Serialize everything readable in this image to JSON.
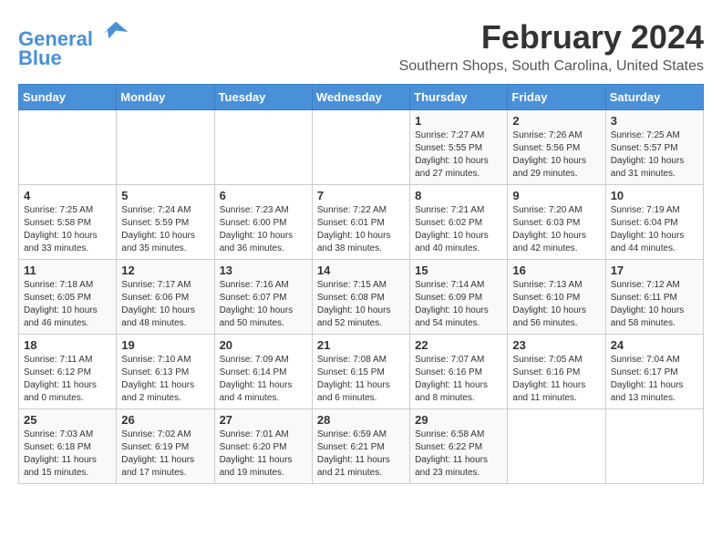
{
  "header": {
    "logo_line1": "General",
    "logo_line2": "Blue",
    "title": "February 2024",
    "subtitle": "Southern Shops, South Carolina, United States"
  },
  "calendar": {
    "days_of_week": [
      "Sunday",
      "Monday",
      "Tuesday",
      "Wednesday",
      "Thursday",
      "Friday",
      "Saturday"
    ],
    "weeks": [
      [
        {
          "day": "",
          "info": ""
        },
        {
          "day": "",
          "info": ""
        },
        {
          "day": "",
          "info": ""
        },
        {
          "day": "",
          "info": ""
        },
        {
          "day": "1",
          "info": "Sunrise: 7:27 AM\nSunset: 5:55 PM\nDaylight: 10 hours\nand 27 minutes."
        },
        {
          "day": "2",
          "info": "Sunrise: 7:26 AM\nSunset: 5:56 PM\nDaylight: 10 hours\nand 29 minutes."
        },
        {
          "day": "3",
          "info": "Sunrise: 7:25 AM\nSunset: 5:57 PM\nDaylight: 10 hours\nand 31 minutes."
        }
      ],
      [
        {
          "day": "4",
          "info": "Sunrise: 7:25 AM\nSunset: 5:58 PM\nDaylight: 10 hours\nand 33 minutes."
        },
        {
          "day": "5",
          "info": "Sunrise: 7:24 AM\nSunset: 5:59 PM\nDaylight: 10 hours\nand 35 minutes."
        },
        {
          "day": "6",
          "info": "Sunrise: 7:23 AM\nSunset: 6:00 PM\nDaylight: 10 hours\nand 36 minutes."
        },
        {
          "day": "7",
          "info": "Sunrise: 7:22 AM\nSunset: 6:01 PM\nDaylight: 10 hours\nand 38 minutes."
        },
        {
          "day": "8",
          "info": "Sunrise: 7:21 AM\nSunset: 6:02 PM\nDaylight: 10 hours\nand 40 minutes."
        },
        {
          "day": "9",
          "info": "Sunrise: 7:20 AM\nSunset: 6:03 PM\nDaylight: 10 hours\nand 42 minutes."
        },
        {
          "day": "10",
          "info": "Sunrise: 7:19 AM\nSunset: 6:04 PM\nDaylight: 10 hours\nand 44 minutes."
        }
      ],
      [
        {
          "day": "11",
          "info": "Sunrise: 7:18 AM\nSunset: 6:05 PM\nDaylight: 10 hours\nand 46 minutes."
        },
        {
          "day": "12",
          "info": "Sunrise: 7:17 AM\nSunset: 6:06 PM\nDaylight: 10 hours\nand 48 minutes."
        },
        {
          "day": "13",
          "info": "Sunrise: 7:16 AM\nSunset: 6:07 PM\nDaylight: 10 hours\nand 50 minutes."
        },
        {
          "day": "14",
          "info": "Sunrise: 7:15 AM\nSunset: 6:08 PM\nDaylight: 10 hours\nand 52 minutes."
        },
        {
          "day": "15",
          "info": "Sunrise: 7:14 AM\nSunset: 6:09 PM\nDaylight: 10 hours\nand 54 minutes."
        },
        {
          "day": "16",
          "info": "Sunrise: 7:13 AM\nSunset: 6:10 PM\nDaylight: 10 hours\nand 56 minutes."
        },
        {
          "day": "17",
          "info": "Sunrise: 7:12 AM\nSunset: 6:11 PM\nDaylight: 10 hours\nand 58 minutes."
        }
      ],
      [
        {
          "day": "18",
          "info": "Sunrise: 7:11 AM\nSunset: 6:12 PM\nDaylight: 11 hours\nand 0 minutes."
        },
        {
          "day": "19",
          "info": "Sunrise: 7:10 AM\nSunset: 6:13 PM\nDaylight: 11 hours\nand 2 minutes."
        },
        {
          "day": "20",
          "info": "Sunrise: 7:09 AM\nSunset: 6:14 PM\nDaylight: 11 hours\nand 4 minutes."
        },
        {
          "day": "21",
          "info": "Sunrise: 7:08 AM\nSunset: 6:15 PM\nDaylight: 11 hours\nand 6 minutes."
        },
        {
          "day": "22",
          "info": "Sunrise: 7:07 AM\nSunset: 6:16 PM\nDaylight: 11 hours\nand 8 minutes."
        },
        {
          "day": "23",
          "info": "Sunrise: 7:05 AM\nSunset: 6:16 PM\nDaylight: 11 hours\nand 11 minutes."
        },
        {
          "day": "24",
          "info": "Sunrise: 7:04 AM\nSunset: 6:17 PM\nDaylight: 11 hours\nand 13 minutes."
        }
      ],
      [
        {
          "day": "25",
          "info": "Sunrise: 7:03 AM\nSunset: 6:18 PM\nDaylight: 11 hours\nand 15 minutes."
        },
        {
          "day": "26",
          "info": "Sunrise: 7:02 AM\nSunset: 6:19 PM\nDaylight: 11 hours\nand 17 minutes."
        },
        {
          "day": "27",
          "info": "Sunrise: 7:01 AM\nSunset: 6:20 PM\nDaylight: 11 hours\nand 19 minutes."
        },
        {
          "day": "28",
          "info": "Sunrise: 6:59 AM\nSunset: 6:21 PM\nDaylight: 11 hours\nand 21 minutes."
        },
        {
          "day": "29",
          "info": "Sunrise: 6:58 AM\nSunset: 6:22 PM\nDaylight: 11 hours\nand 23 minutes."
        },
        {
          "day": "",
          "info": ""
        },
        {
          "day": "",
          "info": ""
        }
      ]
    ]
  }
}
